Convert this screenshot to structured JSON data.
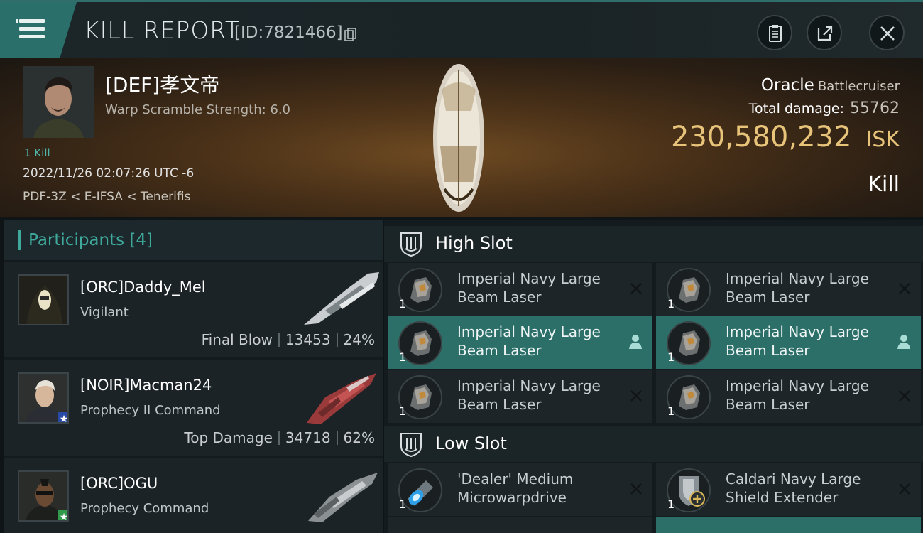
{
  "header": {
    "title": "KILL REPORT",
    "id_label": "[ID:7821466]"
  },
  "victim": {
    "name": "[DEF]孝文帝",
    "warp_scramble": "Warp Scramble Strength: 6.0",
    "kill_count": "1 Kill",
    "date": "2022/11/26 02:07:26 UTC -6",
    "location": "PDF-3Z < E-IFSA < Tenerifis",
    "ship_name": "Oracle",
    "ship_class": "Battlecruiser",
    "total_damage_label": "Total damage:",
    "total_damage": "55762",
    "isk_value": "230,580,232",
    "isk_unit": "ISK",
    "result": "Kill"
  },
  "participants": {
    "label": "Participants",
    "count": "[4]",
    "items": [
      {
        "name": "[ORC]Daddy_Mel",
        "ship": "Vigilant",
        "role": "Final Blow",
        "damage": "13453",
        "percent": "24%"
      },
      {
        "name": "[NOIR]Macman24",
        "ship": "Prophecy II Command",
        "role": "Top Damage",
        "damage": "34718",
        "percent": "62%"
      },
      {
        "name": "[ORC]OGU",
        "ship": "Prophecy Command"
      }
    ]
  },
  "high_slot": {
    "label": "High Slot",
    "modules": [
      {
        "qty": "1",
        "name": "Imperial Navy Large Beam Laser"
      },
      {
        "qty": "1",
        "name": "Imperial Navy Large Beam Laser"
      },
      {
        "qty": "1",
        "name": "Imperial Navy Large Beam Laser"
      },
      {
        "qty": "1",
        "name": "Imperial Navy Large Beam Laser"
      },
      {
        "qty": "1",
        "name": "Imperial Navy Large Beam Laser"
      },
      {
        "qty": "1",
        "name": "Imperial Navy Large Beam Laser"
      }
    ]
  },
  "low_slot": {
    "label": "Low Slot",
    "modules": [
      {
        "qty": "1",
        "name": "'Dealer' Medium Microwarpdrive"
      },
      {
        "qty": "1",
        "name": "Caldari Navy Large Shield Extender"
      }
    ]
  },
  "icons": {
    "menu": "hamburger-icon",
    "copy": "copy-icon",
    "clipboard": "clipboard-icon",
    "share": "share-icon",
    "close": "close-icon",
    "destroyed": "x-icon",
    "dropped": "person-icon"
  },
  "colors": {
    "accent": "#2c6f69",
    "isk": "#e8c37a",
    "teal_text": "#3fa99c"
  }
}
